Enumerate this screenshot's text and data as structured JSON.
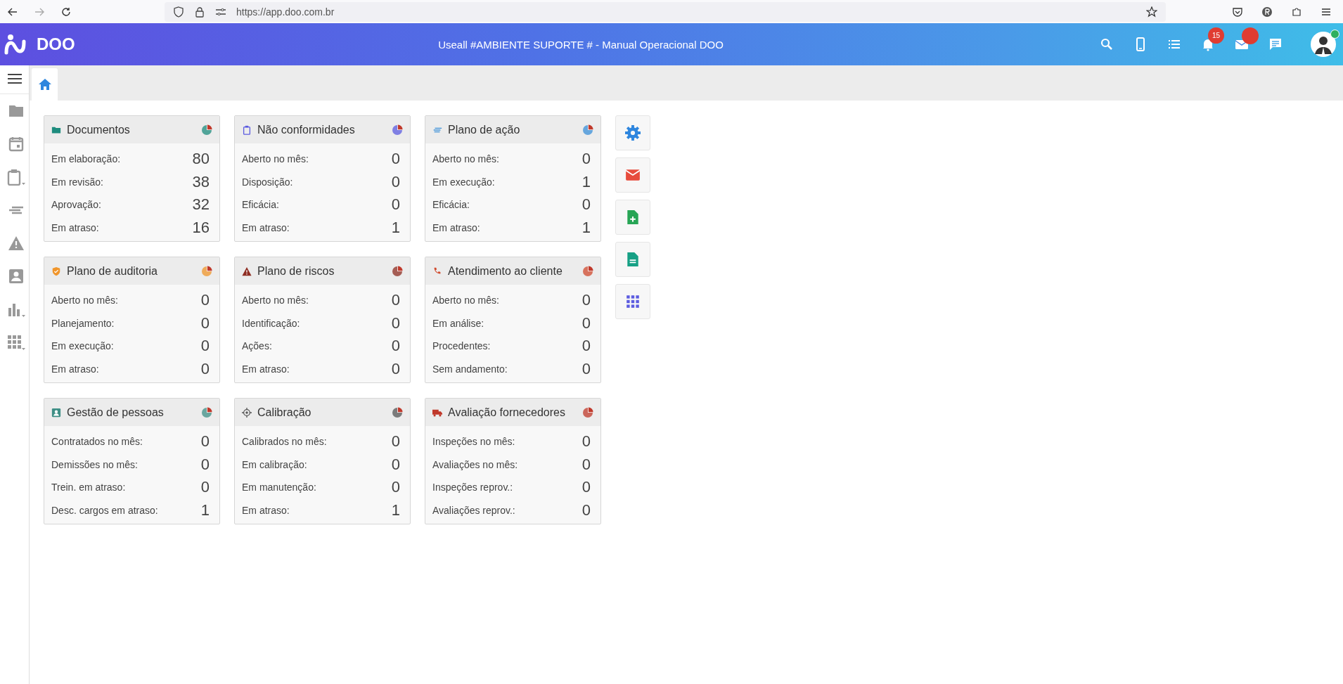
{
  "browser": {
    "url": "https://app.doo.com.br"
  },
  "header": {
    "logo": "DOO",
    "title": "Useall #AMBIENTE SUPORTE # - Manual Operacional DOO",
    "notifications": "15"
  },
  "cards": [
    {
      "title": "Documentos",
      "kind": "folder",
      "color": "#1e8c7e",
      "rows": [
        {
          "label": "Em elaboração:",
          "value": "80"
        },
        {
          "label": "Em revisão:",
          "value": "38"
        },
        {
          "label": "Aprovação:",
          "value": "32"
        },
        {
          "label": "Em atraso:",
          "value": "16"
        }
      ]
    },
    {
      "title": "Não conformidades",
      "kind": "clipboard",
      "color": "#5b5be0",
      "rows": [
        {
          "label": "Aberto no mês:",
          "value": "0"
        },
        {
          "label": "Disposição:",
          "value": "0"
        },
        {
          "label": "Eficácia:",
          "value": "0"
        },
        {
          "label": "Em atraso:",
          "value": "1"
        }
      ]
    },
    {
      "title": "Plano de ação",
      "kind": "lines",
      "color": "#3a8fd8",
      "rows": [
        {
          "label": "Aberto no mês:",
          "value": "0"
        },
        {
          "label": "Em execução:",
          "value": "1"
        },
        {
          "label": "Eficácia:",
          "value": "0"
        },
        {
          "label": "Em atraso:",
          "value": "1"
        }
      ]
    },
    {
      "title": "Plano de auditoria",
      "kind": "shield",
      "color": "#f0952a",
      "rows": [
        {
          "label": "Aberto no mês:",
          "value": "0"
        },
        {
          "label": "Planejamento:",
          "value": "0"
        },
        {
          "label": "Em execução:",
          "value": "0"
        },
        {
          "label": "Em atraso:",
          "value": "0"
        }
      ]
    },
    {
      "title": "Plano de riscos",
      "kind": "warning",
      "color": "#8e2d22",
      "rows": [
        {
          "label": "Aberto no mês:",
          "value": "0"
        },
        {
          "label": "Identificação:",
          "value": "0"
        },
        {
          "label": "Ações:",
          "value": "0"
        },
        {
          "label": "Em atraso:",
          "value": "0"
        }
      ]
    },
    {
      "title": "Atendimento ao cliente",
      "kind": "phone",
      "color": "#d04a2e",
      "rows": [
        {
          "label": "Aberto no mês:",
          "value": "0"
        },
        {
          "label": "Em análise:",
          "value": "0"
        },
        {
          "label": "Procedentes:",
          "value": "0"
        },
        {
          "label": "Sem andamento:",
          "value": "0"
        }
      ]
    },
    {
      "title": "Gestão de pessoas",
      "kind": "person",
      "color": "#3f8f86",
      "rows": [
        {
          "label": "Contratados no mês:",
          "value": "0"
        },
        {
          "label": "Demissões no mês:",
          "value": "0"
        },
        {
          "label": "Trein. em atraso:",
          "value": "0"
        },
        {
          "label": "Desc. cargos em atraso:",
          "value": "1"
        }
      ]
    },
    {
      "title": "Calibração",
      "kind": "target",
      "color": "#555555",
      "rows": [
        {
          "label": "Calibrados no mês:",
          "value": "0"
        },
        {
          "label": "Em calibração:",
          "value": "0"
        },
        {
          "label": "Em manutenção:",
          "value": "0"
        },
        {
          "label": "Em atraso:",
          "value": "1"
        }
      ]
    },
    {
      "title": "Avaliação fornecedores",
      "kind": "truck",
      "color": "#c0392b",
      "rows": [
        {
          "label": "Inspeções no mês:",
          "value": "0"
        },
        {
          "label": "Avaliações no mês:",
          "value": "0"
        },
        {
          "label": "Inspeções reprov.:",
          "value": "0"
        },
        {
          "label": "Avaliações reprov.:",
          "value": "0"
        }
      ]
    }
  ],
  "shortcuts": [
    {
      "kind": "gear",
      "color": "#2e86de"
    },
    {
      "kind": "mail",
      "color": "#e74c3c"
    },
    {
      "kind": "file-plus",
      "color": "#27a555"
    },
    {
      "kind": "file-text",
      "color": "#16a085"
    },
    {
      "kind": "grid",
      "color": "#5b5be0"
    }
  ]
}
